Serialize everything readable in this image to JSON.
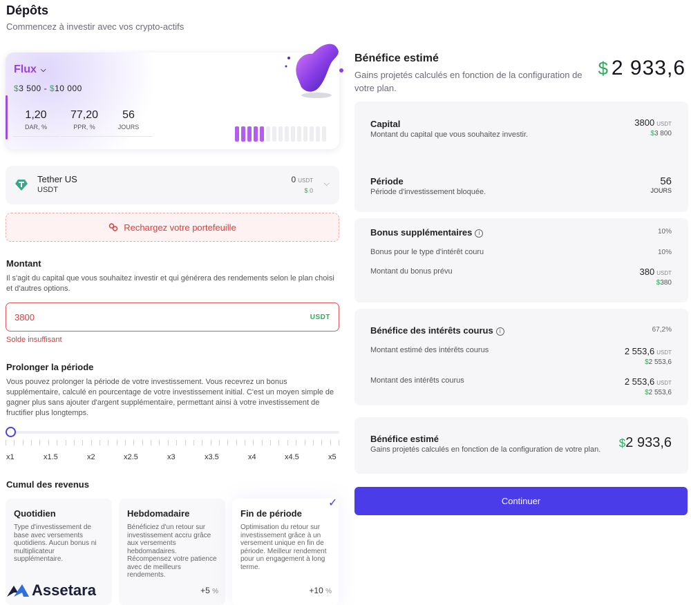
{
  "header": {
    "title": "Dépôts",
    "subtitle": "Commencez à investir avec vos crypto-actifs"
  },
  "plan": {
    "name": "Flux",
    "range_min": "3 500",
    "range_sep": "-",
    "range_max": "10 000",
    "currency_symbol": "$",
    "stats": [
      {
        "value": "1,20",
        "label": "DAR, %"
      },
      {
        "value": "77,20",
        "label": "PPR, %"
      },
      {
        "value": "56",
        "label": "JOURS"
      }
    ],
    "level_filled": 5,
    "level_total": 15
  },
  "token": {
    "name": "Tether US",
    "code": "USDT",
    "balance": "0",
    "balance_unit": "USDT",
    "balance_usd": "0"
  },
  "alert": {
    "text": "Rechargez votre portefeuille"
  },
  "amount": {
    "title": "Montant",
    "description": "Il s'agit du capital que vous souhaitez investir et qui générera des rendements selon le plan choisi et d'autres options.",
    "value": "3800",
    "currency": "USDT",
    "error": "Solde insuffisant"
  },
  "extend": {
    "title": "Prolonger la période",
    "description": "Vous pouvez prolonger la période de votre investissement. Vous recevrez un bonus supplémentaire, calculé en pourcentage de votre investissement initial. C'est un moyen simple de gagner plus sans ajouter d'argent supplémentaire, permettant ainsi à votre investissement de fructifier plus longtemps.",
    "multipliers": [
      "x1",
      "x1.5",
      "x2",
      "x2.5",
      "x3",
      "x3.5",
      "x4",
      "x4.5",
      "x5"
    ],
    "selected": "x1"
  },
  "revenue": {
    "title": "Cumul des revenus",
    "options": [
      {
        "title": "Quotidien",
        "desc": "Type d'investissement de base avec versements quotidiens. Aucun bonus ni multiplicateur supplémentaire.",
        "bonus": "",
        "unit": ""
      },
      {
        "title": "Hebdomadaire",
        "desc": "Bénéficiez d'un retour sur investissement accru grâce aux versements hebdomadaires. Récompensez votre patience avec de meilleurs rendements.",
        "bonus": "+5",
        "unit": "%"
      },
      {
        "title": "Fin de période",
        "desc": "Optimisation du retour sur investissement grâce à un versement unique en fin de période. Meilleur rendement pour un engagement à long terme.",
        "bonus": "+10",
        "unit": "%"
      }
    ],
    "selected": "Fin de période"
  },
  "brand": {
    "name": "Assetara"
  },
  "estimate": {
    "title": "Bénéfice estimé",
    "subtitle": "Gains projetés calculés en fonction de la configuration de votre plan.",
    "total": "2 933,6",
    "capital": {
      "title": "Capital",
      "desc": "Montant du capital que vous souhaitez investir.",
      "value": "3800",
      "unit": "USDT",
      "usd": "3 800"
    },
    "period": {
      "title": "Période",
      "desc": "Période d'investissement bloquée.",
      "value": "56",
      "unit": "JOURS"
    },
    "bonus": {
      "title": "Bonus supplémentaires",
      "pct": "10%",
      "type_label": "Bonus pour le type d'intérêt couru",
      "type_pct": "10%",
      "amount_label": "Montant du bonus prévu",
      "amount": "380",
      "unit": "USDT",
      "usd": "380"
    },
    "interest": {
      "title": "Bénéfice des intérêts courus",
      "pct": "67,2%",
      "est_label": "Montant estimé des intérêts courus",
      "est_value": "2 553,6",
      "est_usd": "2 553,6",
      "cur_label": "Montant des intérêts courus",
      "cur_value": "2 553,6",
      "cur_usd": "2 553,6",
      "unit": "USDT"
    },
    "summary": {
      "title": "Bénéfice estimé",
      "desc": "Gains projetés calculés en fonction de la configuration de votre plan.",
      "value": "2 933,6"
    }
  },
  "actions": {
    "continue": "Continuer"
  },
  "colors": {
    "accent": "#4a3ce8",
    "money": "#2eab5a",
    "plan": "#9b3fe0",
    "error": "#e03b3b"
  }
}
